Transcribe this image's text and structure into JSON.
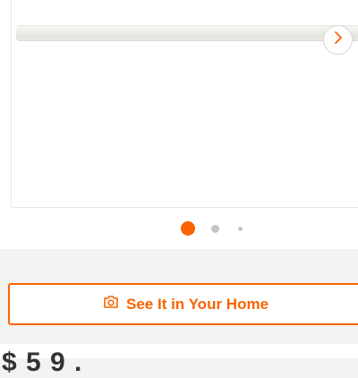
{
  "gallery": {
    "image_alt": "product image",
    "current_slide": 1,
    "slide_count": 3
  },
  "icons": {
    "next": "chevron-right-icon",
    "ar": "camera-icon"
  },
  "ar_button": {
    "label": "See It in Your Home"
  },
  "price": {
    "partial_text": "$ 5 9 ."
  },
  "colors": {
    "accent": "#f96302",
    "dot_inactive": "#c4c4c4",
    "page_background": "#f3f3f3"
  }
}
